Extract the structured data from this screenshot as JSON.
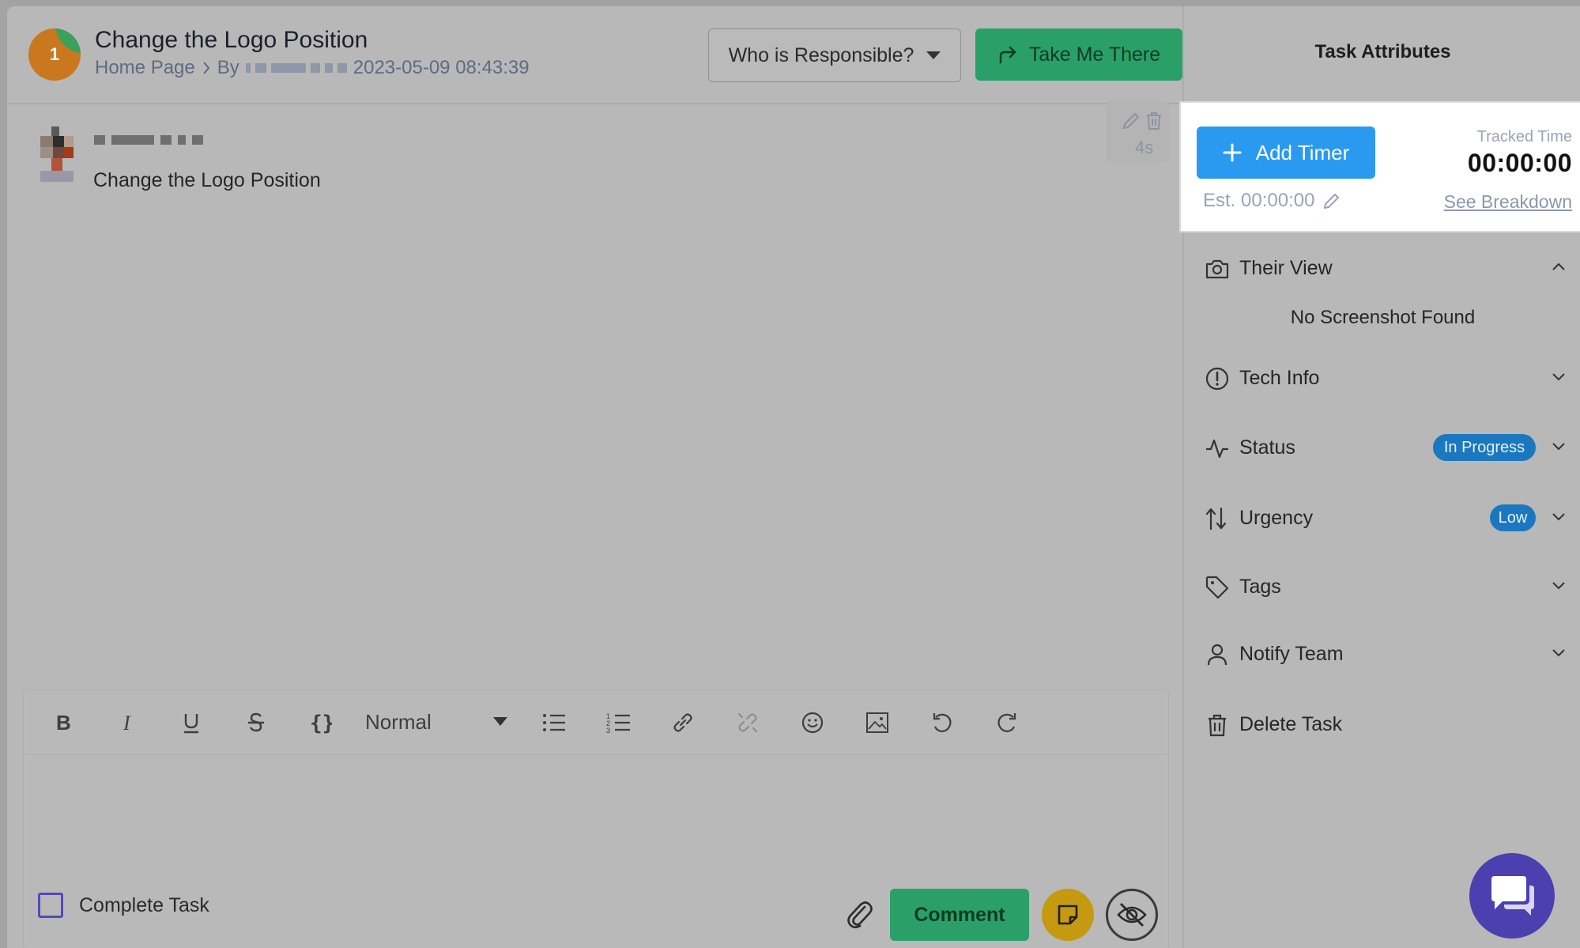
{
  "header": {
    "task_number": "1",
    "title": "Change the Logo Position",
    "breadcrumb_page": "Home Page",
    "by_label": "By",
    "created_at": "2023-05-09 08:43:39",
    "responsible_placeholder": "Who is Responsible?",
    "take_me_there": "Take Me There"
  },
  "thread": {
    "comment_text": "Change the Logo Position",
    "age": "4s"
  },
  "editor": {
    "format_select": "Normal",
    "complete_task": "Complete Task",
    "comment_button": "Comment"
  },
  "panel": {
    "title": "Task Attributes",
    "add_timer": "Add Timer",
    "estimate": "Est. 00:00:00",
    "tracked_label": "Tracked Time",
    "tracked_value": "00:00:00",
    "see_breakdown": "See Breakdown",
    "their_view": "Their View",
    "no_screenshot": "No Screenshot Found",
    "tech_info": "Tech Info",
    "status": "Status",
    "status_value": "In Progress",
    "urgency": "Urgency",
    "urgency_value": "Low",
    "tags": "Tags",
    "notify_team": "Notify Team",
    "delete_task": "Delete Task"
  },
  "colors": {
    "primary_green": "#2aa068",
    "timer_blue": "#2a9af1",
    "badge_blue": "#1b78bf",
    "chat_purple": "#4c3fb0",
    "note_yellow": "#c59a10"
  }
}
